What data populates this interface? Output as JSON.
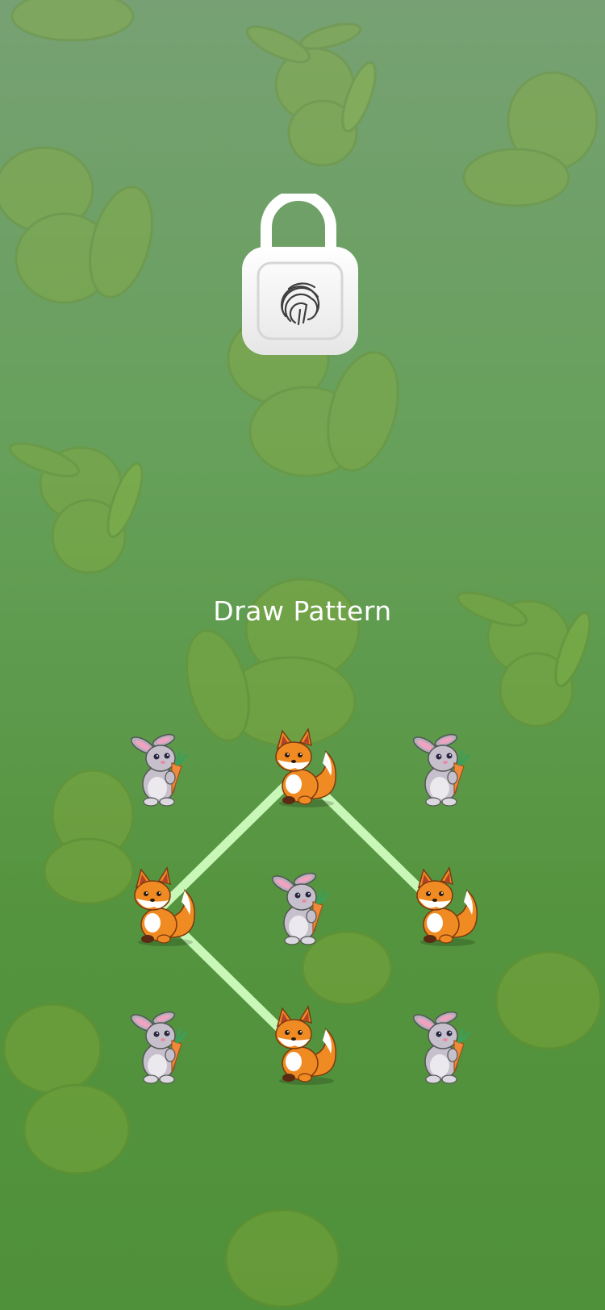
{
  "screen": {
    "title": "Draw Pattern"
  },
  "lock_icon": {
    "name": "padlock-fingerprint-icon",
    "color": "#ffffff"
  },
  "pattern_grid": {
    "rows": 3,
    "cols": 3,
    "nodes": [
      {
        "row": 0,
        "col": 0,
        "character": "rabbit",
        "selected": false
      },
      {
        "row": 0,
        "col": 1,
        "character": "fox",
        "selected": true
      },
      {
        "row": 0,
        "col": 2,
        "character": "rabbit",
        "selected": false
      },
      {
        "row": 1,
        "col": 0,
        "character": "fox",
        "selected": true
      },
      {
        "row": 1,
        "col": 1,
        "character": "rabbit",
        "selected": false
      },
      {
        "row": 1,
        "col": 2,
        "character": "fox",
        "selected": true
      },
      {
        "row": 2,
        "col": 0,
        "character": "rabbit",
        "selected": false
      },
      {
        "row": 2,
        "col": 1,
        "character": "fox",
        "selected": true
      },
      {
        "row": 2,
        "col": 2,
        "character": "rabbit",
        "selected": false
      }
    ],
    "path": [
      [
        1,
        2
      ],
      [
        0,
        1
      ],
      [
        1,
        0
      ],
      [
        2,
        1
      ]
    ],
    "line_color": "#c8f7b8"
  },
  "colors": {
    "background_top": "#77a174",
    "background_bottom": "#4f903a",
    "text": "#ffffff"
  }
}
